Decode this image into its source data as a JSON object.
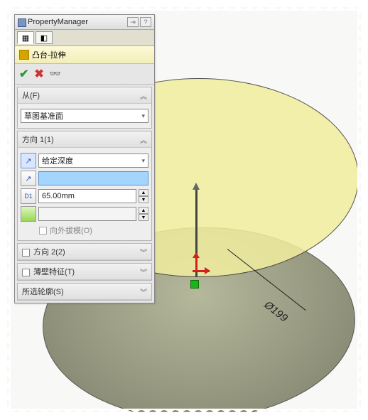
{
  "header": {
    "title": "PropertyManager"
  },
  "feature": {
    "name": "凸台-拉伸"
  },
  "from": {
    "label": "从(F)",
    "selection": "草图基准面"
  },
  "direction1": {
    "label": "方向 1(1)",
    "end_condition": "给定深度",
    "depth": "65.00mm",
    "draft_label": "向外拔模(O)"
  },
  "direction2": {
    "label": "方向 2(2)"
  },
  "thin": {
    "label": "薄壁特征(T)"
  },
  "contours": {
    "label": "所选轮廓(S)"
  },
  "dimension": {
    "diameter": "Ø199"
  },
  "icons": {
    "reverse": "↗",
    "dir_arrow": "↗",
    "d1": "D1"
  }
}
